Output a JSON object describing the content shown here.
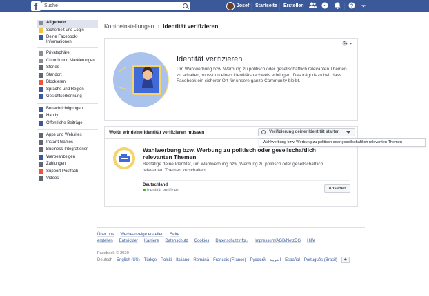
{
  "topbar": {
    "logo": "f",
    "search_placeholder": "Suche",
    "user_name": "Josef",
    "home_label": "Startseite",
    "create_label": "Erstellen",
    "help_label": "?"
  },
  "sidebar": {
    "group1": [
      {
        "label": "Allgemein",
        "active": true,
        "icon_color": "#8a8d91"
      },
      {
        "label": "Sicherheit und Login",
        "active": false,
        "icon_color": "#f5c33b"
      },
      {
        "label": "Deine Facebook-Informationen",
        "active": false,
        "icon_color": "#3b5998"
      }
    ],
    "group2": [
      {
        "label": "Privatsphäre",
        "icon_color": "#8a8d91"
      },
      {
        "label": "Chronik und Markierungen",
        "icon_color": "#8a8d91"
      },
      {
        "label": "Stories",
        "icon_color": "#606770"
      },
      {
        "label": "Standort",
        "icon_color": "#606770"
      },
      {
        "label": "Blockieren",
        "icon_color": "#e9573e"
      },
      {
        "label": "Sprache und Region",
        "icon_color": "#3b5998"
      },
      {
        "label": "Gesichtserkennung",
        "icon_color": "#3b5998"
      }
    ],
    "group3": [
      {
        "label": "Benachrichtigungen",
        "icon_color": "#3b5998"
      },
      {
        "label": "Handy",
        "icon_color": "#606770"
      },
      {
        "label": "Öffentliche Beiträge",
        "icon_color": "#3b5998"
      }
    ],
    "group4": [
      {
        "label": "Apps und Websites",
        "icon_color": "#606770"
      },
      {
        "label": "Instant Games",
        "icon_color": "#606770"
      },
      {
        "label": "Business-Integrationen",
        "icon_color": "#606770"
      },
      {
        "label": "Werbeanzeigen",
        "icon_color": "#3b5998"
      },
      {
        "label": "Zahlungen",
        "icon_color": "#606770"
      },
      {
        "label": "Support-Postfach",
        "icon_color": "#e9573e"
      },
      {
        "label": "Videos",
        "icon_color": "#606770"
      }
    ]
  },
  "breadcrumb": {
    "parent": "Kontoeinstellungen",
    "separator": "›",
    "current": "Identität verifizieren"
  },
  "hero": {
    "title": "Identität verifizieren",
    "text": "Um Wahlwerbung bzw. Werbung zu politisch oder gesellschaftlich relevanten Themen zu schalten, musst du einen Identitätsnachweis erbringen. Das trägt dazu bei, dass Facebook ein sicherer Ort für unsere ganze Community bleibt."
  },
  "section": {
    "title": "Wofür wir deine Identität verifizieren müssen",
    "start_button": "Verifizierung deiner Identität starten",
    "tooltip": "Wahlwerbung bzw. Werbung zu politisch oder gesellschaftlich relevanten Themen",
    "card_title": "Wahlwerbung bzw. Werbung zu politisch oder gesellschaftlich relevanten Themen",
    "card_text": "Bestätige deine Identität, um Wahlwerbung bzw. Werbung zu politisch oder gesellschaftlich relevanten Themen zu schalten.",
    "country": "Deutschland",
    "status": "Identität verifiziert",
    "view_button": "Ansehen"
  },
  "footer": {
    "links": [
      "Über uns",
      "Werbeanzeige erstellen",
      "Seite erstellen",
      "Entwickler",
      "Karriere",
      "Datenschutz",
      "Cookies",
      "Datenschutzinfo▷",
      "Impressum/AGB/NetzDG",
      "Hilfe"
    ],
    "copyright": "Facebook © 2020",
    "current_language": "Deutsch",
    "languages": [
      "English (US)",
      "Türkçe",
      "Polski",
      "Italiano",
      "Română",
      "Français (France)",
      "Русский",
      "العربية",
      "Español",
      "Português (Brasil)"
    ],
    "more": "+"
  },
  "colors": {
    "brand": "#3b5998",
    "hero_circle": "#a9c3ec",
    "verified_green": "#42b72a"
  }
}
